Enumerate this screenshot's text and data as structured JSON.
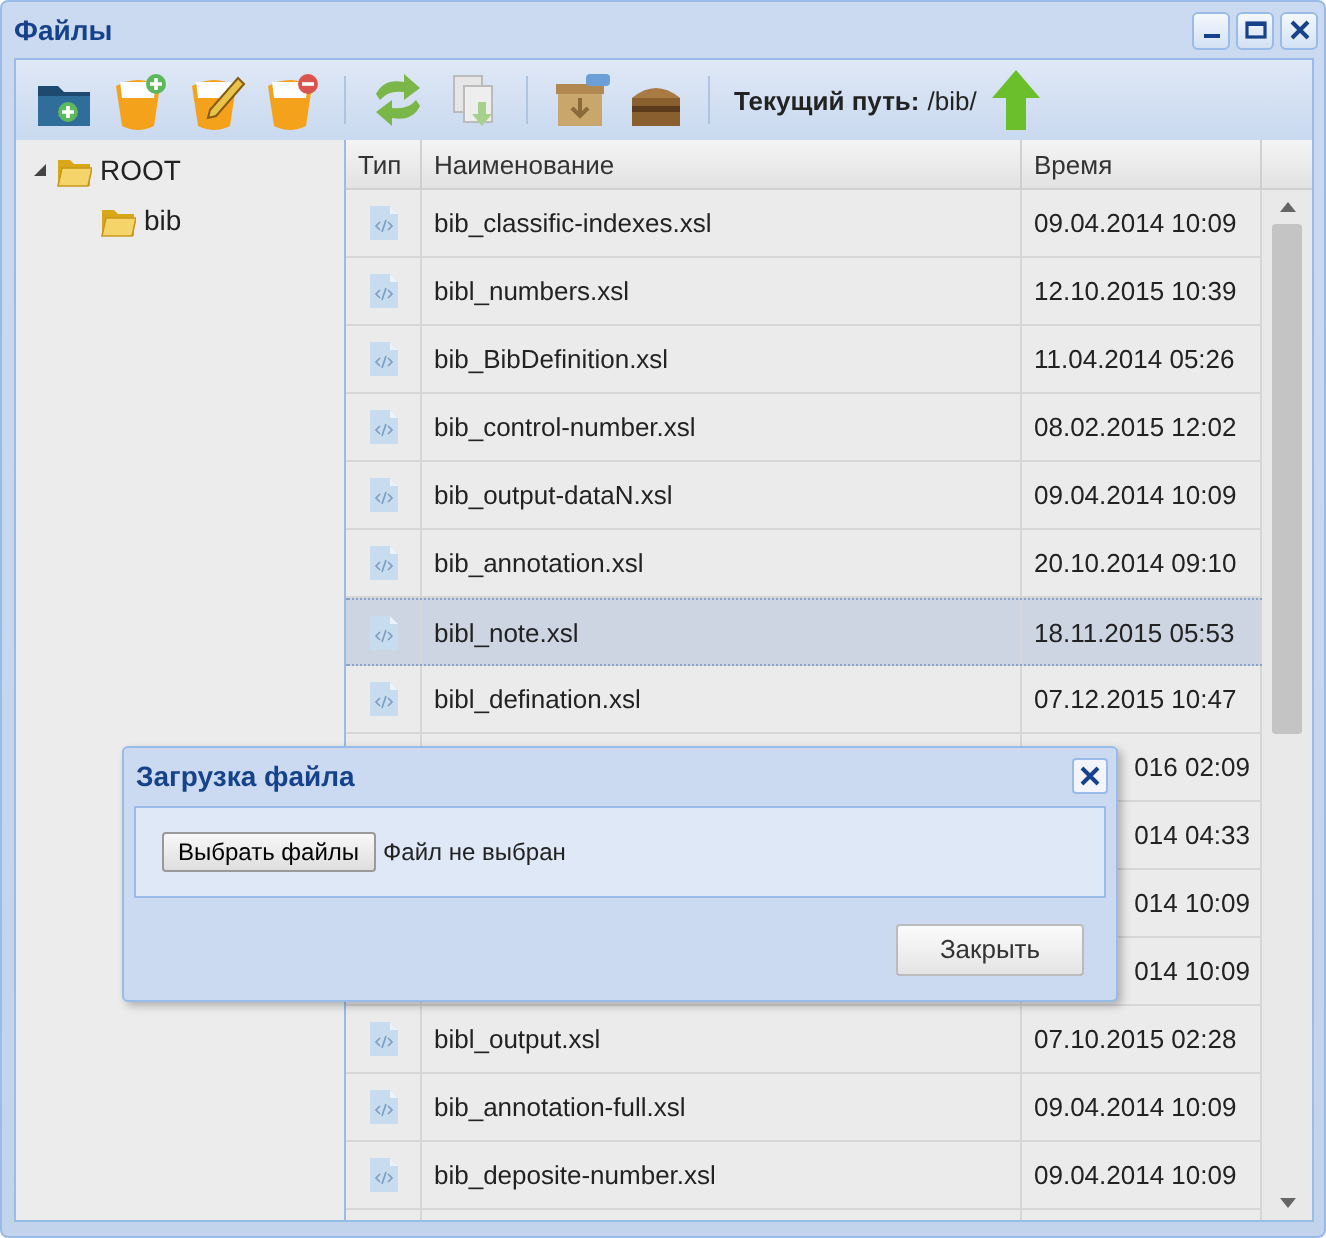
{
  "window": {
    "title": "Файлы"
  },
  "toolbar": {
    "path_label": "Текущий путь:",
    "path": "/bib/"
  },
  "tree": [
    {
      "label": "ROOT",
      "expanded": true,
      "children": [
        {
          "label": "bib"
        }
      ]
    }
  ],
  "table": {
    "columns": [
      "Тип",
      "Наименование",
      "Время"
    ],
    "rows": [
      {
        "kind": "file",
        "name": "bib_classific-indexes.xsl",
        "time": "09.04.2014 10:09",
        "selected": false
      },
      {
        "kind": "file",
        "name": "bibl_numbers.xsl",
        "time": "12.10.2015 10:39",
        "selected": false
      },
      {
        "kind": "file",
        "name": "bib_BibDefinition.xsl",
        "time": "11.04.2014 05:26",
        "selected": false
      },
      {
        "kind": "file",
        "name": "bib_control-number.xsl",
        "time": "08.02.2015 12:02",
        "selected": false
      },
      {
        "kind": "file",
        "name": "bib_output-dataN.xsl",
        "time": "09.04.2014 10:09",
        "selected": false
      },
      {
        "kind": "file",
        "name": "bib_annotation.xsl",
        "time": "20.10.2014 09:10",
        "selected": false
      },
      {
        "kind": "file",
        "name": "bibl_note.xsl",
        "time": "18.11.2015 05:53",
        "selected": true
      },
      {
        "kind": "file",
        "name": "bibl_defination.xsl",
        "time": "07.12.2015 10:47",
        "selected": false
      },
      {
        "kind": "covered",
        "time": "016 02:09",
        "selected": false
      },
      {
        "kind": "covered",
        "time": "014 04:33",
        "selected": false
      },
      {
        "kind": "covered",
        "time": "014 10:09",
        "selected": false
      },
      {
        "kind": "covered",
        "time": "014 10:09",
        "selected": false
      },
      {
        "kind": "file",
        "name": "bibl_output.xsl",
        "time": "07.10.2015 02:28",
        "selected": false
      },
      {
        "kind": "file",
        "name": "bib_annotation-full.xsl",
        "time": "09.04.2014 10:09",
        "selected": false
      },
      {
        "kind": "file",
        "name": "bib_deposite-number.xsl",
        "time": "09.04.2014 10:09",
        "selected": false
      }
    ]
  },
  "dialog": {
    "title": "Загрузка файла",
    "choose_button": "Выбрать файлы",
    "file_status": "Файл не выбран",
    "close_button": "Закрыть"
  }
}
